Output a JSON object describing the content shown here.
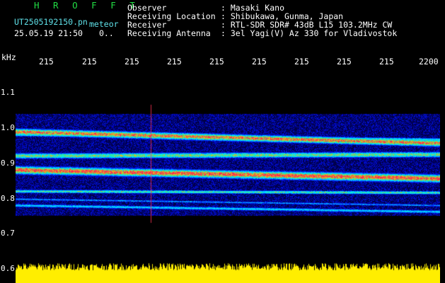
{
  "header": {
    "program": "H R O F F T",
    "filename": "UT2505192150.pn",
    "meteor_label": "meteor",
    "datetime": "25.05.19 21:50",
    "count": "0..",
    "observer_label": "Observer",
    "observer_value": ": Masaki Kano",
    "location_label": "Receiving Location",
    "location_value": ": Shibukawa, Gunma, Japan",
    "receiver_label": "Receiver",
    "receiver_value": ": RTL-SDR SDR# 43dB L15 103.2MHz CW",
    "antenna_label": "Receiving Antenna",
    "antenna_value": ": 3el Yagi(V) Az 330 for Vladivostok"
  },
  "axes": {
    "unit": "kHz",
    "x_ticks": [
      "215",
      "215",
      "215",
      "215",
      "215",
      "215",
      "215",
      "215",
      "215",
      "2200"
    ],
    "y_ticks": [
      "1.1",
      "1.0",
      "0.9",
      "0.8",
      "0.7",
      "0.6"
    ]
  },
  "colors": {
    "background": "#000000",
    "spectrum": "#ffee00",
    "signal_line": "#ff3355",
    "header_accent": "#22dd44"
  }
}
